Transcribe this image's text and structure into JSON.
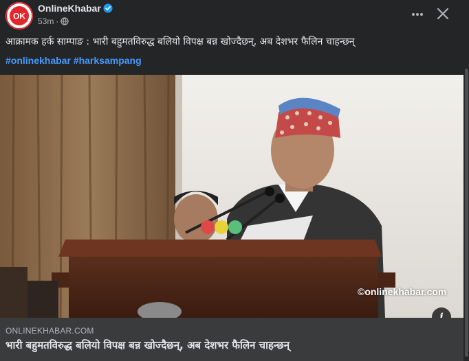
{
  "post": {
    "page_name": "OnlineKhabar",
    "time_ago": "53m",
    "dot": "·",
    "privacy_icon": "globe-icon",
    "caption": "आक्रामक हर्क साम्पाङ : भारी बहुमतविरुद्ध बलियो विपक्ष बन्न खोज्दैछन्, अब देशभर फैलिन चाहन्छन्",
    "hashtags": [
      "#onlinekhabar",
      "#harksampang"
    ],
    "more_icon": "more-horizontal-icon",
    "close_icon": "close-icon"
  },
  "link_card": {
    "domain": "ONLINEKHABAR.COM",
    "title": "भारी बहुमतविरुद्ध बलियो विपक्ष बन्न खोज्दैछन्, अब देशभर फैलिन चाहन्छन्",
    "watermark": "©onlinekhabar.com",
    "info_label": "i"
  },
  "colors": {
    "background": "#242526",
    "accent_link": "#4599ff",
    "verified": "#1d9bf0",
    "card_footer": "#3a3b3c",
    "logo_red": "#e3262b"
  }
}
